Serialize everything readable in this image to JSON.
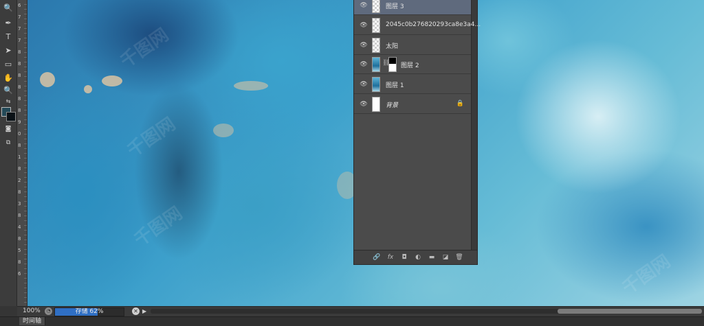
{
  "toolbar": {
    "tools": [
      {
        "name": "zoom-tool-icon",
        "glyph": "🔍"
      },
      {
        "name": "pen-tool-icon",
        "glyph": "✒"
      },
      {
        "name": "type-tool-icon",
        "glyph": "T"
      },
      {
        "name": "path-select-tool-icon",
        "glyph": "➤"
      },
      {
        "name": "rectangle-tool-icon",
        "glyph": "▭"
      },
      {
        "name": "hand-tool-icon",
        "glyph": "✋"
      },
      {
        "name": "zoom-tool-2-icon",
        "glyph": "🔍"
      }
    ],
    "foreground_color": "#244a58",
    "background_color": "#0b1217"
  },
  "ruler": {
    "labels": [
      "6",
      "7",
      "7",
      "7",
      "8",
      "8",
      "8",
      "8",
      "8",
      "8",
      "9",
      "0",
      "8",
      "1",
      "8",
      "2",
      "8",
      "3",
      "8",
      "4",
      "8",
      "5",
      "8",
      "6"
    ]
  },
  "layers": {
    "items": [
      {
        "name": "图层 3",
        "thumb": "transparent",
        "selected": true
      },
      {
        "name": "2045c0b276820293ca8e3a4...",
        "thumb": "transparent",
        "selected": false
      },
      {
        "name": "太阳",
        "thumb": "transparent",
        "selected": false
      },
      {
        "name": "图层 2",
        "thumb": "img",
        "mask": true,
        "selected": false
      },
      {
        "name": "图层 1",
        "thumb": "img",
        "selected": false
      },
      {
        "name": "背景",
        "thumb": "white",
        "italic": true,
        "locked": true,
        "selected": false
      }
    ],
    "footer_icons": [
      "link-icon",
      "fx-icon",
      "mask-icon",
      "adjustment-icon",
      "folder-icon",
      "new-layer-icon",
      "trash-icon"
    ]
  },
  "status": {
    "zoom": "100%",
    "progress_label": "存储 62%",
    "progress_percent": 62
  },
  "timeline": {
    "tab_label": "时间轴"
  },
  "watermark": {
    "text": "千图网"
  }
}
